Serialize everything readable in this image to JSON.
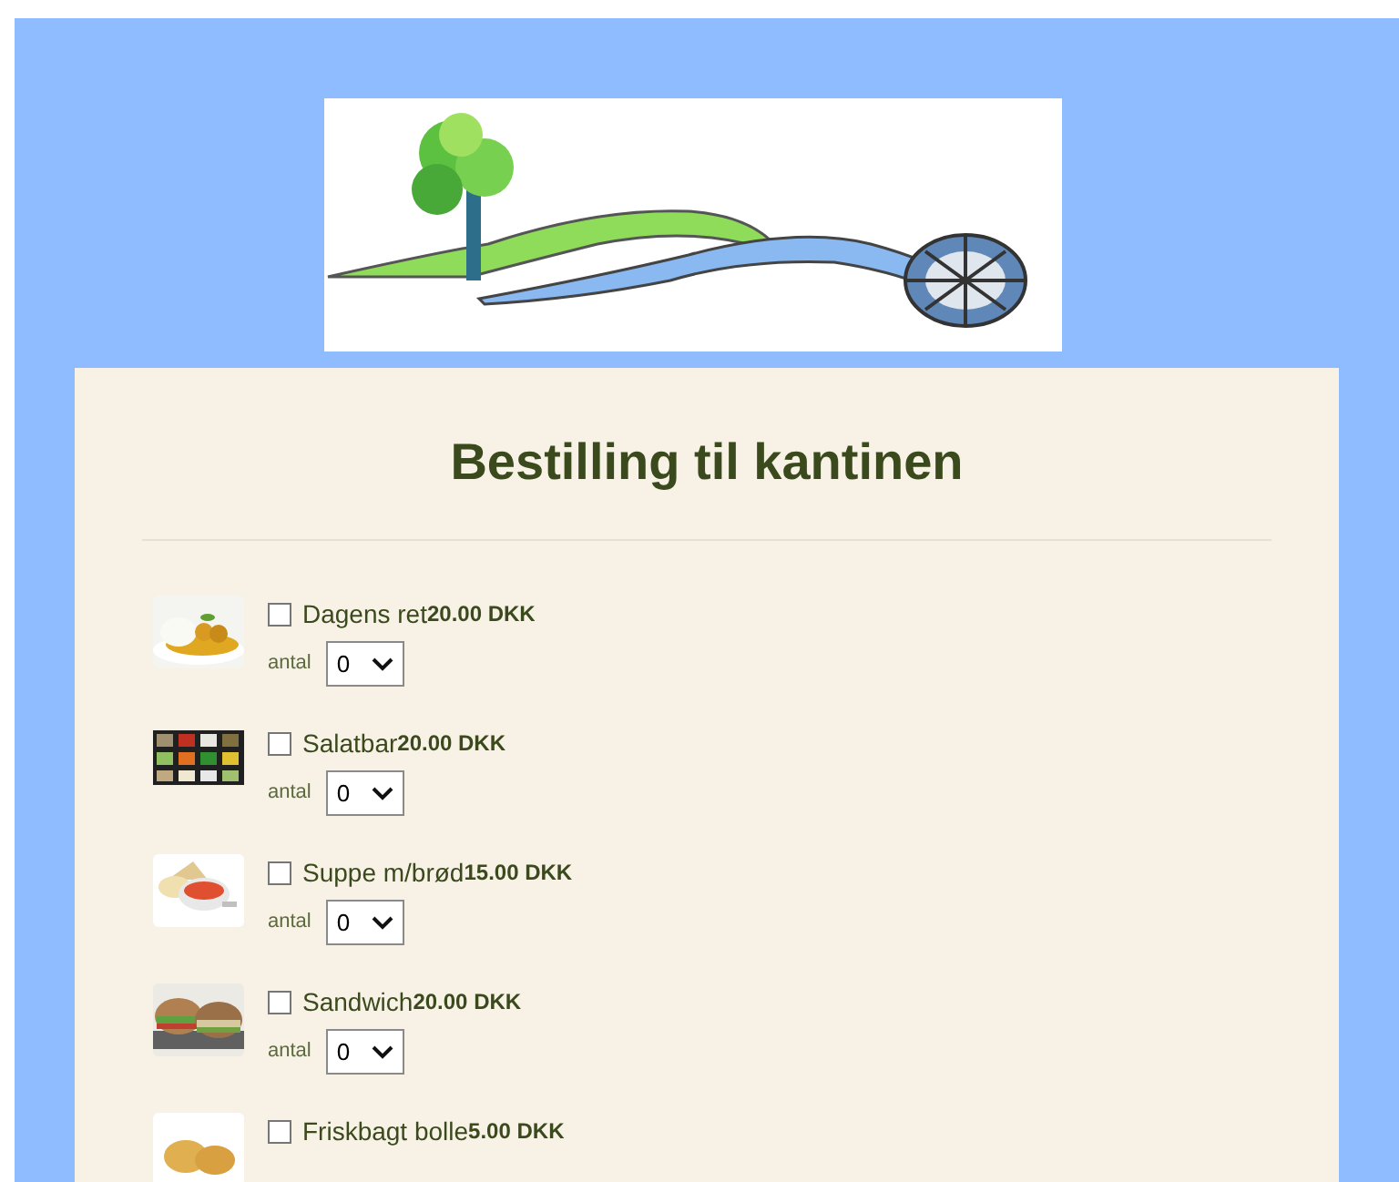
{
  "title": "Bestilling til kantinen",
  "items": [
    {
      "name": "Dagens ret",
      "price": "20.00 DKK",
      "checked": false,
      "quantity_label": "antal",
      "quantity": "0"
    },
    {
      "name": "Salatbar",
      "price": "20.00 DKK",
      "checked": false,
      "quantity_label": "antal",
      "quantity": "0"
    },
    {
      "name": "Suppe m/brød",
      "price": "15.00 DKK",
      "checked": false,
      "quantity_label": "antal",
      "quantity": "0"
    },
    {
      "name": "Sandwich",
      "price": "20.00 DKK",
      "checked": false,
      "quantity_label": "antal",
      "quantity": "0"
    },
    {
      "name": "Friskbagt bolle",
      "price": "5.00 DKK",
      "checked": false
    }
  ]
}
